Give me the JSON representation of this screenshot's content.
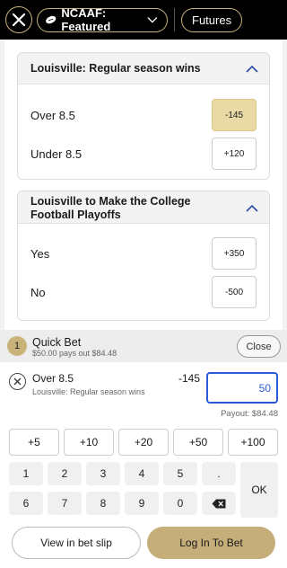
{
  "nav": {
    "featured_label": "NCAAF: Featured",
    "futures_label": "Futures"
  },
  "markets": [
    {
      "title": "Louisville: Regular season wins",
      "outcomes": [
        {
          "label": "Over 8.5",
          "odds": "-145",
          "selected": true
        },
        {
          "label": "Under 8.5",
          "odds": "+120",
          "selected": false
        }
      ]
    },
    {
      "title": "Louisville to Make the College Football Playoffs",
      "outcomes": [
        {
          "label": "Yes",
          "odds": "+350",
          "selected": false
        },
        {
          "label": "No",
          "odds": "-500",
          "selected": false
        }
      ]
    }
  ],
  "slip": {
    "count": "1",
    "title": "Quick Bet",
    "subtitle": "$50.00 pays out $84.48",
    "close_label": "Close",
    "bet": {
      "label": "Over 8.5",
      "market": "Louisville: Regular season wins",
      "odds": "-145",
      "stake": "50",
      "payout": "Payout: $84.48"
    },
    "quick_amounts": [
      "+5",
      "+10",
      "+20",
      "+50",
      "+100"
    ],
    "keypad": [
      "1",
      "2",
      "3",
      "4",
      "5",
      ".",
      "6",
      "7",
      "8",
      "9",
      "0"
    ],
    "ok_label": "OK",
    "view_label": "View in bet slip",
    "login_label": "Log In To Bet"
  },
  "colors": {
    "accent_gold": "#c9b37a",
    "selected_bg": "#e8d9a5",
    "stake_blue": "#2a5bd7"
  }
}
